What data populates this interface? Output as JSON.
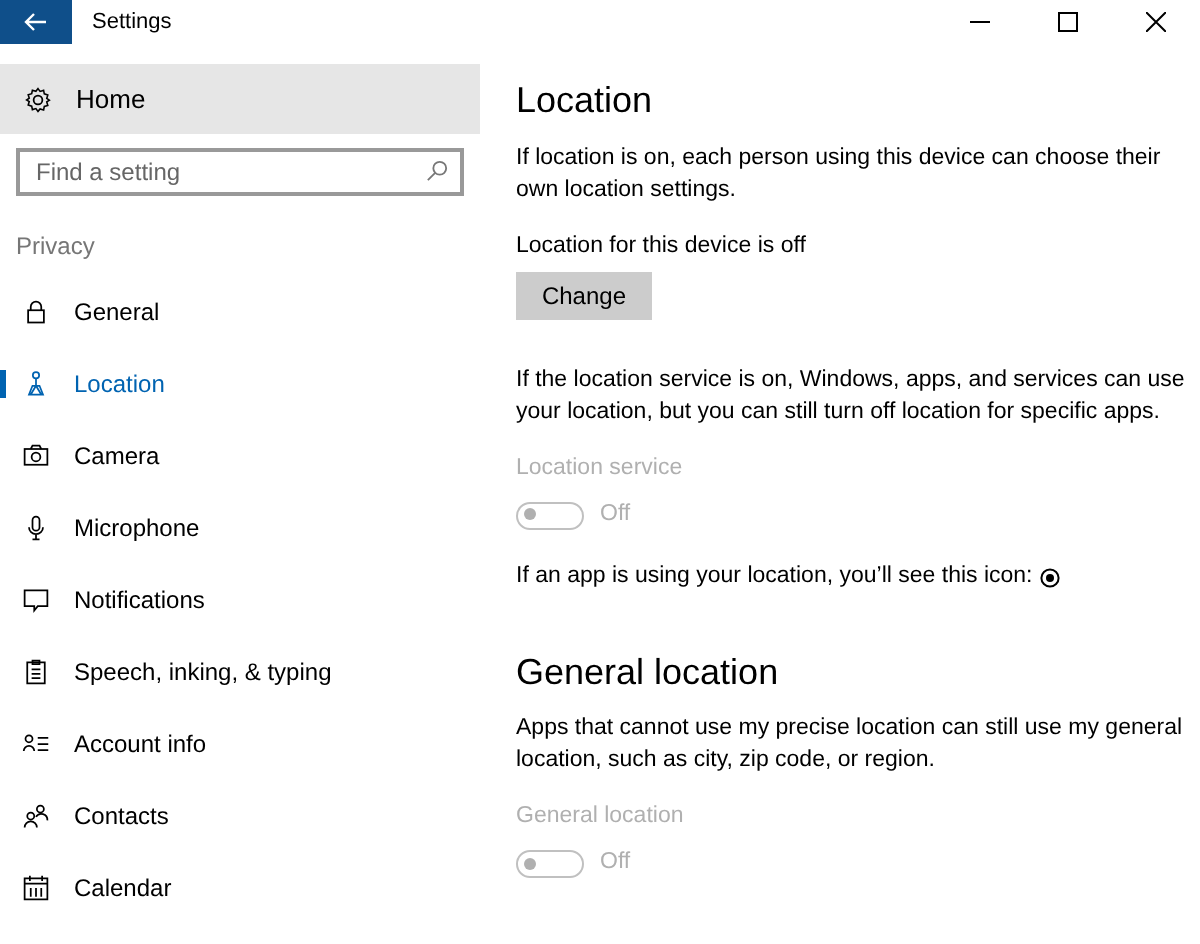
{
  "window": {
    "title": "Settings"
  },
  "sidebar": {
    "home": "Home",
    "search": {
      "placeholder": "Find a setting"
    },
    "section": "Privacy",
    "items": [
      {
        "label": "General",
        "selected": false
      },
      {
        "label": "Location",
        "selected": true
      },
      {
        "label": "Camera",
        "selected": false
      },
      {
        "label": "Microphone",
        "selected": false
      },
      {
        "label": "Notifications",
        "selected": false
      },
      {
        "label": "Speech, inking, & typing",
        "selected": false
      },
      {
        "label": "Account info",
        "selected": false
      },
      {
        "label": "Contacts",
        "selected": false
      },
      {
        "label": "Calendar",
        "selected": false
      }
    ]
  },
  "content": [
    {
      "kind": "heading",
      "text": "Location"
    },
    {
      "kind": "paragraph",
      "text": "If location is on, each person using this device can choose their own location settings."
    },
    {
      "kind": "status",
      "text": "Location for this device is off"
    },
    {
      "kind": "button",
      "text": "Change"
    },
    {
      "kind": "paragraph",
      "text": "If the location service is on, Windows, apps, and services can use your location, but you can still turn off location for specific apps."
    },
    {
      "kind": "toggle",
      "label": "Location service",
      "state": "Off",
      "on": false,
      "disabled": true
    },
    {
      "kind": "icon_note",
      "text": "If an app is using your location, you’ll see this icon:"
    },
    {
      "kind": "heading",
      "text": "General location"
    },
    {
      "kind": "paragraph",
      "text": "Apps that cannot use my precise location can still use my general location, such as city, zip code, or region."
    },
    {
      "kind": "toggle",
      "label": "General location",
      "state": "Off",
      "on": false,
      "disabled": true
    }
  ]
}
